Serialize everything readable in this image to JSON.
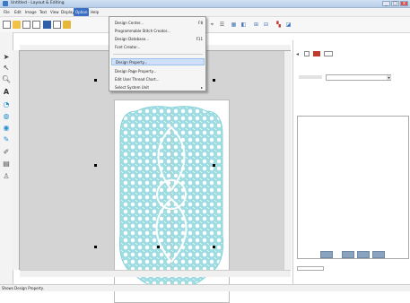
{
  "window": {
    "title": "Untitled - Layout & Editing",
    "min": "_",
    "max": "□",
    "close": "x"
  },
  "menubar": [
    "File",
    "Edit",
    "Image",
    "Text",
    "View",
    "Display",
    "Option",
    "Help"
  ],
  "option_menu": [
    {
      "label": "Design Center...",
      "shortcut": "F8"
    },
    {
      "label": "Programmable Stitch Creator...",
      "shortcut": ""
    },
    {
      "label": "Design Database...",
      "shortcut": "F11"
    },
    {
      "label": "Font Creator...",
      "shortcut": ""
    },
    {
      "label": "Design Property...",
      "shortcut": ""
    },
    {
      "label": "Design Page Property...",
      "shortcut": ""
    },
    {
      "label": "Edit User Thread Chart...",
      "shortcut": ""
    },
    {
      "label": "Select System Unit",
      "shortcut": "▸"
    }
  ],
  "status": "Shows Design Property.",
  "colors": {
    "embroidery": "#9fdde2",
    "menu_highlight": "#cde0f7",
    "active_menu": "#3a6fc4"
  }
}
